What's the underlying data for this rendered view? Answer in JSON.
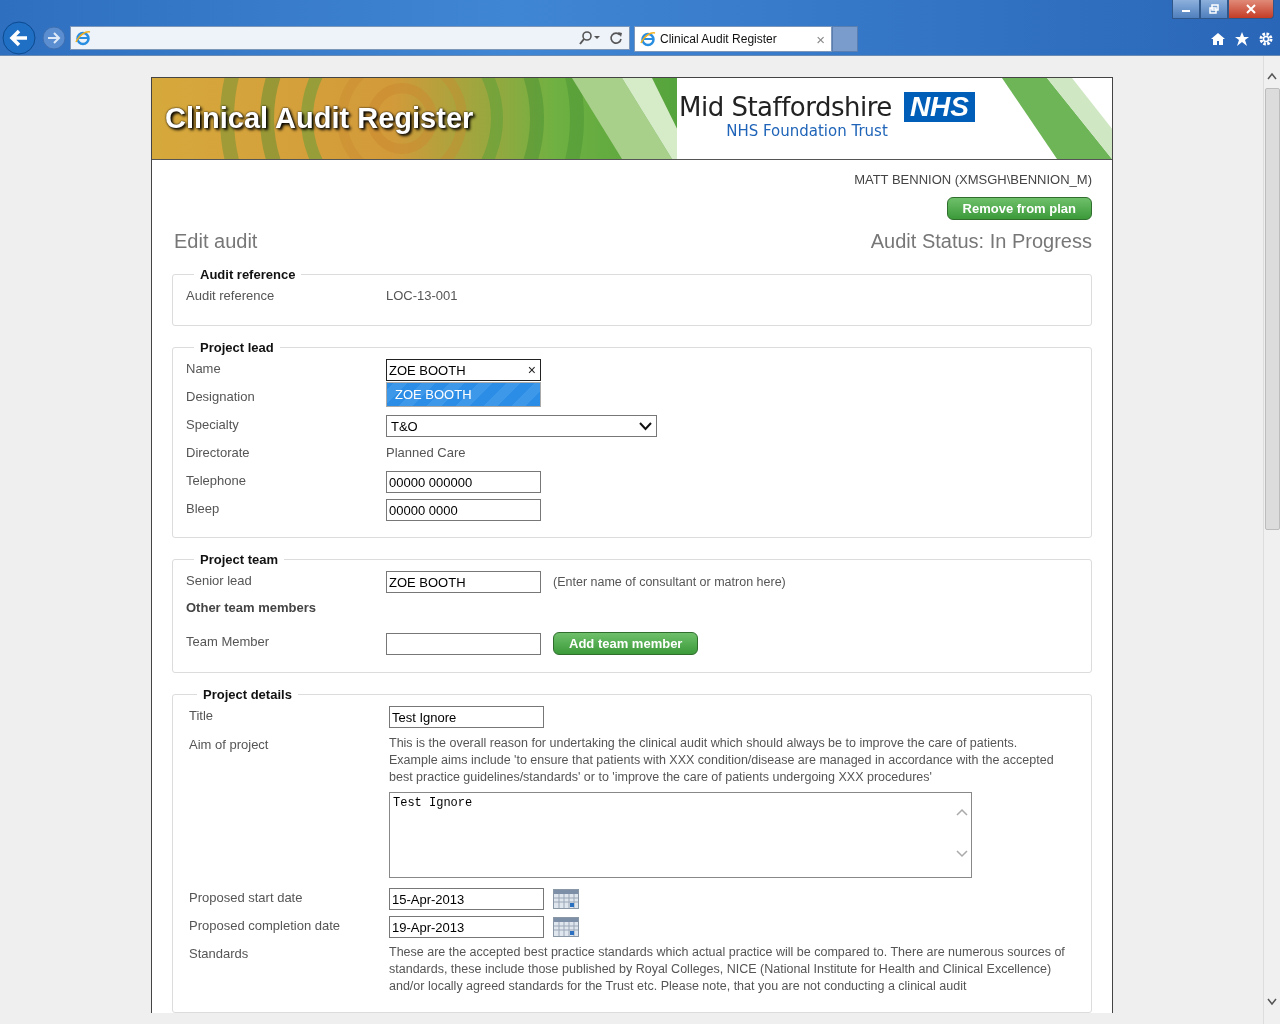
{
  "browser": {
    "tab_title": "Clinical Audit Register",
    "tab_close": "×"
  },
  "header": {
    "title": "Clinical Audit Register",
    "org_name": "Mid Staffordshire",
    "org_badge": "NHS",
    "org_subtitle": "NHS Foundation Trust"
  },
  "user": "MATT BENNION (XMSGH\\BENNION_M)",
  "remove_button": "Remove from plan",
  "page_title": "Edit audit",
  "status": "Audit Status: In Progress",
  "sections": [
    {
      "legend": "Audit reference",
      "rows": [
        {
          "kind": "text",
          "label": "Audit reference",
          "value": "LOC-13-001"
        }
      ]
    },
    {
      "legend": "Project lead",
      "rows": [
        {
          "kind": "autocomplete",
          "label": "Name",
          "value": "ZOE BOOTH",
          "clear": "×",
          "suggestion": "ZOE BOOTH"
        },
        {
          "kind": "blank",
          "label": "Designation"
        },
        {
          "kind": "select",
          "label": "Specialty",
          "value": "T&O"
        },
        {
          "kind": "text",
          "label": "Directorate",
          "value": "Planned Care"
        },
        {
          "kind": "input",
          "label": "Telephone",
          "value": "00000 000000"
        },
        {
          "kind": "input",
          "label": "Bleep",
          "value": "00000 0000"
        }
      ]
    },
    {
      "legend": "Project team",
      "rows": [
        {
          "kind": "input",
          "label": "Senior lead",
          "value": "ZOE BOOTH",
          "hint": "(Enter name of consultant or matron here)"
        },
        {
          "kind": "subheading",
          "label": "Other team members"
        },
        {
          "kind": "input",
          "label": "Team Member",
          "value": "",
          "button": "Add team member"
        }
      ]
    },
    {
      "legend": "Project details",
      "rows": [
        {
          "kind": "input",
          "label": "Title",
          "value": "Test Ignore"
        },
        {
          "kind": "textarea",
          "label": "Aim of project",
          "help": "This is the overall reason for undertaking the clinical audit which should always be to improve the care of patients. Example aims include 'to ensure that patients with XXX condition/disease are managed in accordance with the accepted best practice guidelines/standards' or to 'improve the care of patients undergoing XXX procedures'",
          "value": "Test Ignore"
        },
        {
          "kind": "date",
          "label": "Proposed start date",
          "value": "15-Apr-2013"
        },
        {
          "kind": "date",
          "label": "Proposed completion date",
          "value": "19-Apr-2013"
        },
        {
          "kind": "help",
          "label": "Standards",
          "help": "These are the accepted best practice standards which actual practice will be compared to. There are numerous sources of standards, these include those published by Royal Colleges, NICE (National Institute for Health and Clinical Excellence) and/or locally agreed standards for the Trust etc. Please note, that you are not conducting a clinical audit"
        }
      ]
    }
  ]
}
